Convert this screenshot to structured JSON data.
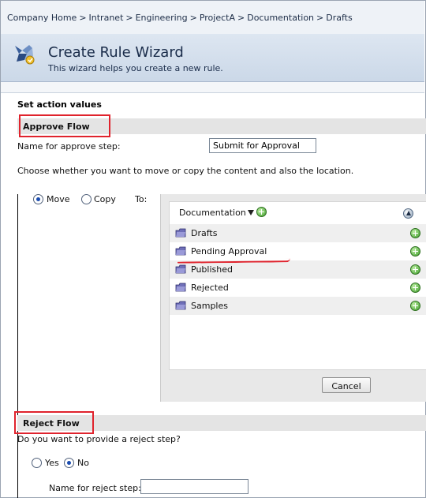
{
  "breadcrumb": {
    "items": [
      "Company Home",
      "Intranet",
      "Engineering",
      "ProjectA",
      "Documentation",
      "Drafts"
    ],
    "separator": ">"
  },
  "wizard": {
    "title": "Create Rule Wizard",
    "subtitle": "This wizard helps you create a new rule.",
    "icon": "wizard-icon"
  },
  "section_title": "Set action values",
  "approve": {
    "header": "Approve Flow",
    "name_label": "Name for approve step:",
    "name_value": "Submit for Approval",
    "instructions": "Choose whether you want to move or copy the content and also the location.",
    "move_label": "Move",
    "copy_label": "Copy",
    "selected_action": "Move",
    "to_label": "To:"
  },
  "picker": {
    "current_folder": "Documentation",
    "folders": [
      {
        "label": "Drafts"
      },
      {
        "label": "Pending Approval"
      },
      {
        "label": "Published"
      },
      {
        "label": "Rejected"
      },
      {
        "label": "Samples"
      }
    ],
    "cancel_label": "Cancel"
  },
  "reject": {
    "header": "Reject Flow",
    "question": "Do you want to provide a reject step?",
    "yes_label": "Yes",
    "no_label": "No",
    "selected": "No",
    "name_label": "Name for reject step:",
    "name_value": ""
  },
  "colors": {
    "highlight_red": "#e0232d",
    "header_bg": "#cbd8e8",
    "bar_bg": "#e4e4e4",
    "radio_dot": "#1a4cb0",
    "add_icon_green": "#3c9b28"
  }
}
